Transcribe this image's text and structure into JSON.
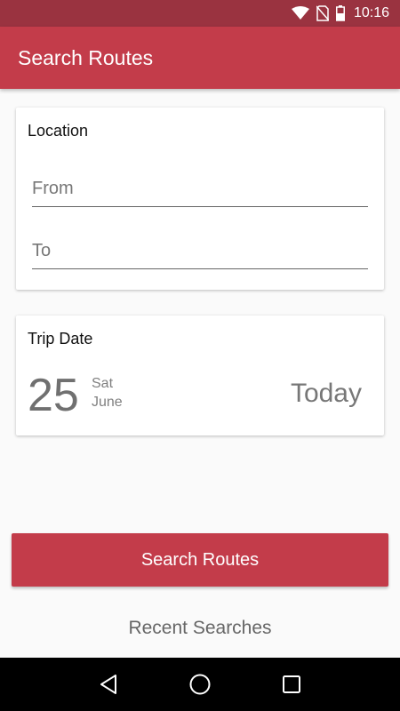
{
  "status_bar": {
    "time": "10:16",
    "icons": [
      "wifi-icon",
      "no-sim-icon",
      "battery-icon"
    ]
  },
  "app_bar": {
    "title": "Search Routes"
  },
  "location_card": {
    "title": "Location",
    "from_placeholder": "From",
    "from_value": "",
    "to_placeholder": "To",
    "to_value": ""
  },
  "date_card": {
    "title": "Trip Date",
    "day": "25",
    "weekday": "Sat",
    "month": "June",
    "relative": "Today"
  },
  "search_button": {
    "label": "Search Routes"
  },
  "recent_searches": {
    "label": "Recent Searches"
  },
  "nav_bar": {
    "buttons": [
      "back-icon",
      "home-icon",
      "recents-icon"
    ]
  },
  "colors": {
    "primary": "#c33c4a",
    "primary_dark": "#9a3340",
    "background": "#fafafa"
  }
}
